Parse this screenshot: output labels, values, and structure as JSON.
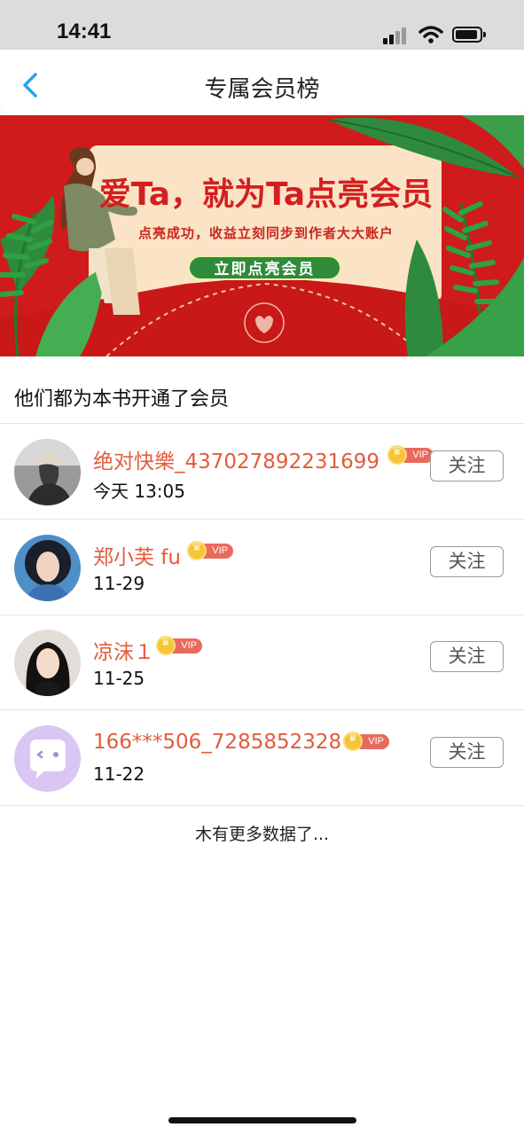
{
  "status_bar": {
    "time": "14:41"
  },
  "nav": {
    "title": "专属会员榜"
  },
  "banner": {
    "headline": "爱Ta，就为Ta点亮会员",
    "subtitle": "点亮成功，收益立刻同步到作者大大账户",
    "cta": "立即点亮会员"
  },
  "section": {
    "heading": "他们都为本书开通了会员"
  },
  "members": [
    {
      "name": "绝对快樂_437027892231699",
      "date": "今天 13:05",
      "badge": "VIP",
      "follow": "关注"
    },
    {
      "name": "郑小芙 fu",
      "date": "11-29",
      "badge": "VIP",
      "follow": "关注"
    },
    {
      "name": "凉沫１",
      "date": "11-25",
      "badge": "VIP",
      "follow": "关注"
    },
    {
      "name": "166***506_7285852328",
      "date": "11-22",
      "badge": "VIP",
      "follow": "关注"
    }
  ],
  "footer": {
    "end_text": "木有更多数据了..."
  },
  "colors": {
    "accent": "#2aa3e8",
    "name": "#e35b3c",
    "banner_red": "#cf1b1b"
  }
}
